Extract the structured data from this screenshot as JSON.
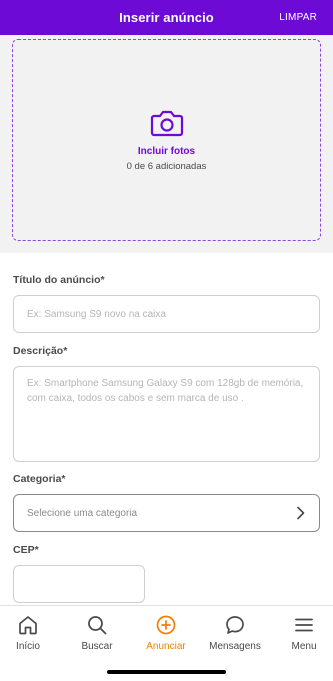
{
  "header": {
    "title": "Inserir anúncio",
    "clear_label": "LIMPAR",
    "background": "#6e0ad6"
  },
  "photos": {
    "label": "Incluir fotos",
    "count": "0 de 6 adicionadas",
    "icon": "camera-icon",
    "accent": "#6e0ad6"
  },
  "form": {
    "title_label": "Título do anúncio*",
    "title_placeholder": "Ex: Samsung S9 novo na caixa",
    "description_label": "Descrição*",
    "description_placeholder": "Ex: Smartphone Samsung Galaxy S9 com 128gb de memória, com caixa, todos os cabos e sem marca de uso .",
    "category_label": "Categoria*",
    "category_placeholder": "Selecione uma categoria",
    "cep_label": "CEP*",
    "cep_value": ""
  },
  "tabbar": {
    "active_color": "#f28000",
    "items": [
      {
        "label": "Início",
        "icon": "home-icon"
      },
      {
        "label": "Buscar",
        "icon": "search-icon"
      },
      {
        "label": "Anunciar",
        "icon": "plus-circle-icon"
      },
      {
        "label": "Mensagens",
        "icon": "chat-bubble-icon"
      },
      {
        "label": "Menu",
        "icon": "hamburger-menu-icon"
      }
    ]
  }
}
